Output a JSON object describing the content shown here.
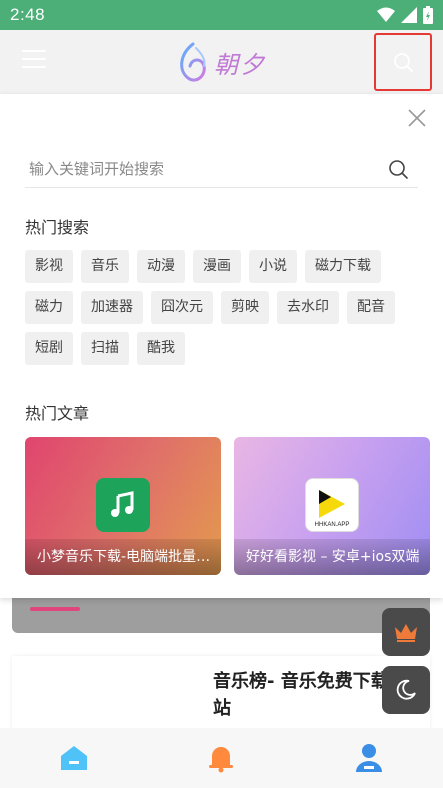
{
  "status_bar": {
    "time": "2:48"
  },
  "header": {
    "logo_text": "朝夕"
  },
  "search": {
    "placeholder": "输入关键词开始搜索",
    "hot_search_title": "热门搜索",
    "hot_tags": [
      "影视",
      "音乐",
      "动漫",
      "漫画",
      "小说",
      "磁力下载",
      "磁力",
      "加速器",
      "囧次元",
      "剪映",
      "去水印",
      "配音",
      "短剧",
      "扫描",
      "酷我"
    ],
    "hot_articles_title": "热门文章",
    "articles": [
      {
        "title": "小梦音乐下载-电脑端批量下载",
        "icon": "music-note-icon"
      },
      {
        "title": "好好看影视 – 安卓+ios双端",
        "icon": "hhkan-app-icon",
        "icon_label": "HHKAN.APP"
      }
    ]
  },
  "background": {
    "article_title": "音乐榜- 音乐免费下载站"
  },
  "colors": {
    "status_bar": "#4caf78",
    "accent_red": "#e53935",
    "logo": "#c07ad6"
  }
}
